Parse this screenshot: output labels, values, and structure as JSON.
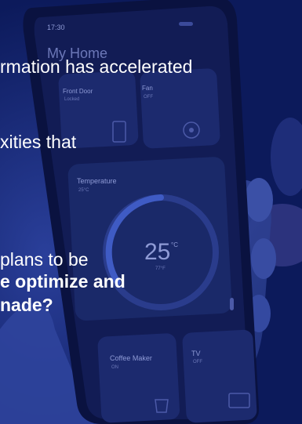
{
  "phone": {
    "time": "17:30",
    "title": "My Home",
    "tiles": [
      {
        "name": "Front Door",
        "status": "Locked"
      },
      {
        "name": "Fan",
        "status": "OFF"
      },
      {
        "name": "Temperature",
        "status": "25°C"
      },
      {
        "name": "Coffee Maker",
        "status": "ON"
      },
      {
        "name": "TV",
        "status": "OFF"
      }
    ],
    "thermostat": {
      "value": "25",
      "unit": "°C",
      "sub": "77°F"
    }
  },
  "slide": {
    "lines": [
      {
        "text": "rmation has accelerated",
        "bold": false
      },
      {
        "text": "xities that",
        "bold": false
      },
      {
        "text": "plans to be",
        "bold": false
      },
      {
        "text": "e optimize and",
        "bold": true
      },
      {
        "text": "nade?",
        "bold": true
      }
    ]
  },
  "colors": {
    "overlay": "#0b1a5a",
    "text": "#ffffff"
  }
}
